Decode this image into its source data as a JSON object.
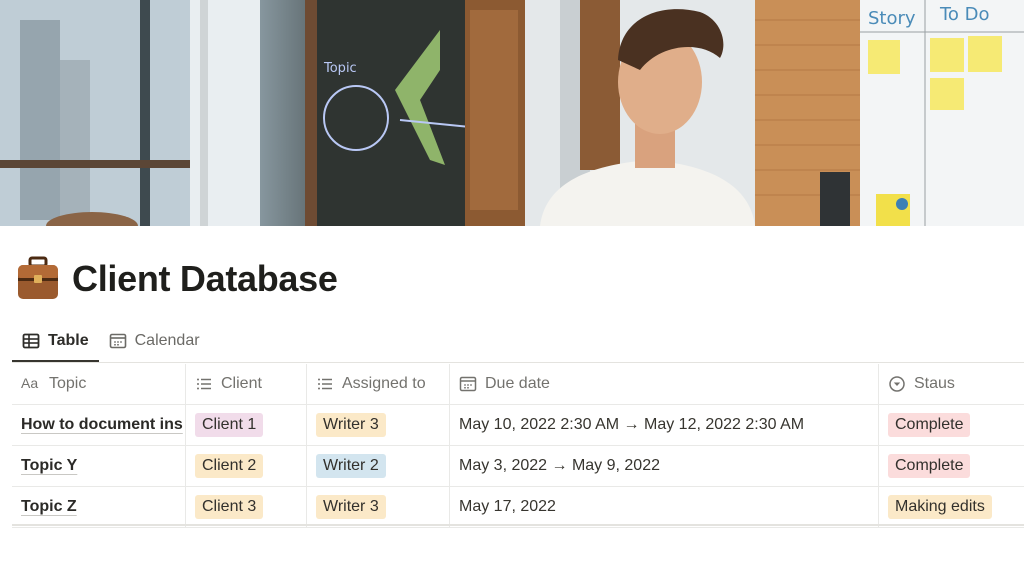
{
  "page": {
    "title": "Client Database",
    "icon": "briefcase-icon"
  },
  "cover": {
    "description_icon": "cover-photo",
    "whiteboard_labels": [
      "Story",
      "To Do"
    ],
    "chalkboard_label": "Topic"
  },
  "views": [
    {
      "label": "Table",
      "icon": "table-icon",
      "active": true
    },
    {
      "label": "Calendar",
      "icon": "calendar-icon",
      "active": false
    }
  ],
  "table": {
    "columns": [
      {
        "label": "Topic",
        "icon": "text-icon"
      },
      {
        "label": "Client",
        "icon": "list-icon"
      },
      {
        "label": "Assigned to",
        "icon": "list-icon"
      },
      {
        "label": "Due date",
        "icon": "calendar-icon"
      },
      {
        "label": "Staus",
        "icon": "status-icon"
      }
    ],
    "rows": [
      {
        "topic": "How to document ins",
        "client": "Client 1",
        "assigned": "Writer 3",
        "due": "May 10, 2022 2:30 AM → May 12, 2022 2:30 AM",
        "status": "Complete"
      },
      {
        "topic": "Topic Y",
        "client": "Client 2",
        "assigned": "Writer 2",
        "due": "May 3, 2022 → May 9, 2022",
        "status": "Complete"
      },
      {
        "topic": "Topic Z",
        "client": "Client 3",
        "assigned": "Writer 3",
        "due": "May 17, 2022",
        "status": "Making edits"
      }
    ]
  },
  "colors": {
    "client_1": "#f1dcea",
    "client_2": "#fbe9c8",
    "client_3": "#fbe9c8",
    "writer_3": "#fbe9c8",
    "writer_2": "#d3e5ef",
    "status_complete": "#fbdcdc",
    "status_making_edits": "#fbe9c8"
  }
}
